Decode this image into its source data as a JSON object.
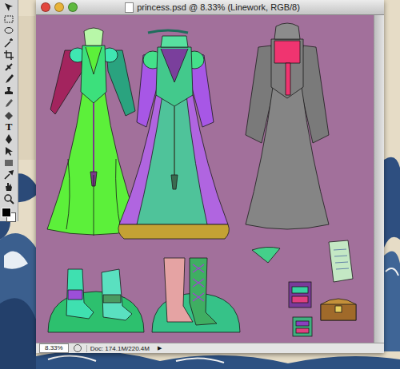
{
  "window": {
    "title": "princess.psd @ 8.33% (Linework, RGB/8)"
  },
  "toolbox": {
    "type_tool_glyph": "T"
  },
  "status_bar": {
    "zoom": "8.33%",
    "doc_info": "Doc: 174.1M/220.4M",
    "menu_arrow": "▶"
  }
}
